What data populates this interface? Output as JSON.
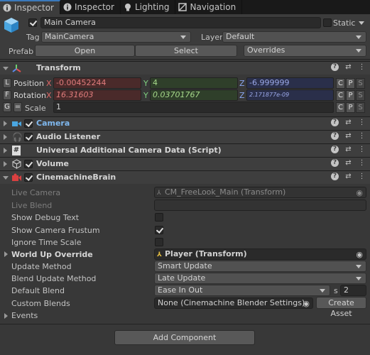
{
  "tabs": [
    {
      "label": "Inspector",
      "icon": "info-icon",
      "active": true
    },
    {
      "label": "Inspector",
      "icon": "info-icon",
      "active": false
    },
    {
      "label": "Lighting",
      "icon": "bulb-icon",
      "active": false
    },
    {
      "label": "Navigation",
      "icon": "navigation-icon",
      "active": false
    }
  ],
  "gameobject": {
    "name": "Main Camera",
    "static_label": "Static",
    "tag_label": "Tag",
    "tag_value": "MainCamera",
    "layer_label": "Layer",
    "layer_value": "Default",
    "prefab_label": "Prefab",
    "open_label": "Open",
    "select_label": "Select",
    "overrides_label": "Overrides"
  },
  "transform": {
    "title": "Transform",
    "position": {
      "label": "Position",
      "tag": "L",
      "x": "-0.00452244",
      "y": "4",
      "z": "-6.999999"
    },
    "rotation": {
      "label": "Rotation",
      "tag": "F",
      "x": "16.31603",
      "y": "0.03701767",
      "z": "2.171877e-09"
    },
    "scale": {
      "label": "Scale",
      "tag": "G",
      "value": "1"
    },
    "axis": {
      "x": "X",
      "y": "Y",
      "z": "Z"
    },
    "cp": {
      "c": "C",
      "p": "P",
      "s": "S"
    }
  },
  "components": [
    {
      "title": "Camera",
      "icon": "camera-icon",
      "highlight": true
    },
    {
      "title": "Audio Listener",
      "icon": "headphones-icon"
    },
    {
      "title": "Universal Additional Camera Data (Script)",
      "icon": "script-icon"
    },
    {
      "title": "Volume",
      "icon": "cube-icon"
    }
  ],
  "brain": {
    "title": "CinemachineBrain",
    "rows": {
      "live_camera": {
        "label": "Live Camera",
        "value": "CM_FreeLook_Main (Transform)"
      },
      "live_blend": {
        "label": "Live Blend",
        "value": ""
      },
      "show_debug": {
        "label": "Show Debug Text",
        "checked": false
      },
      "show_frustum": {
        "label": "Show Camera Frustum",
        "checked": true
      },
      "ignore_time": {
        "label": "Ignore Time Scale",
        "checked": false
      },
      "world_up": {
        "label": "World Up Override",
        "value": "Player (Transform)"
      },
      "update_method": {
        "label": "Update Method",
        "value": "Smart Update"
      },
      "blend_update": {
        "label": "Blend Update Method",
        "value": "Late Update"
      },
      "default_blend": {
        "label": "Default Blend",
        "value": "Ease In Out",
        "s_label": "s",
        "s_value": "2"
      },
      "custom_blends": {
        "label": "Custom Blends",
        "value": "None (Cinemachine Blender Settings)",
        "create_label": "Create Asset"
      },
      "events": {
        "label": "Events"
      }
    }
  },
  "add_component": "Add Component",
  "colors": {
    "accent": "#3a79bb",
    "pos_x_bg": "#4a2a2a",
    "pos_y_bg": "#2f3f2a",
    "pos_z_bg": "#2a2f4a"
  }
}
